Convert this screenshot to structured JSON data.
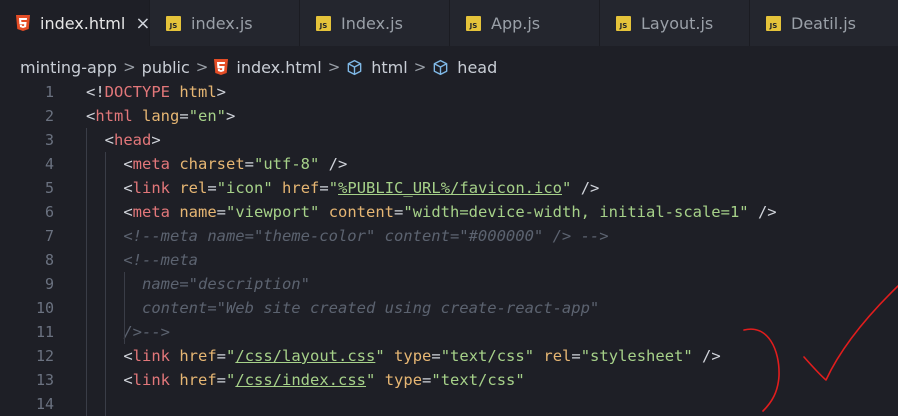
{
  "tabs": [
    {
      "label": "index.html",
      "icon": "html5-icon",
      "active": true,
      "close": "×"
    },
    {
      "label": "index.js",
      "icon": "js-file-icon"
    },
    {
      "label": "Index.js",
      "icon": "js-file-icon"
    },
    {
      "label": "App.js",
      "icon": "js-file-icon"
    },
    {
      "label": "Layout.js",
      "icon": "js-file-icon"
    },
    {
      "label": "Deatil.js",
      "icon": "js-file-icon"
    }
  ],
  "breadcrumb": {
    "items": [
      "minting-app",
      "public",
      "index.html",
      "html",
      "head"
    ],
    "separator": ">"
  },
  "code": {
    "lines": [
      {
        "num": "1",
        "tokens": [
          [
            "p",
            "<!"
          ],
          [
            "tag",
            "DOCTYPE"
          ],
          [
            "p",
            " "
          ],
          [
            "attr",
            "html"
          ],
          [
            "p",
            ">"
          ]
        ]
      },
      {
        "num": "2",
        "tokens": [
          [
            "p",
            "<"
          ],
          [
            "tag",
            "html"
          ],
          [
            "p",
            " "
          ],
          [
            "attr",
            "lang"
          ],
          [
            "p",
            "="
          ],
          [
            "str",
            "\"en\""
          ],
          [
            "p",
            ">"
          ]
        ]
      },
      {
        "num": "3",
        "tokens": [
          [
            "p",
            "  <"
          ],
          [
            "tag",
            "head"
          ],
          [
            "p",
            ">"
          ]
        ]
      },
      {
        "num": "4",
        "tokens": [
          [
            "p",
            "    <"
          ],
          [
            "tag",
            "meta"
          ],
          [
            "p",
            " "
          ],
          [
            "attr",
            "charset"
          ],
          [
            "p",
            "="
          ],
          [
            "str",
            "\"utf-8\""
          ],
          [
            "p",
            " />"
          ]
        ]
      },
      {
        "num": "5",
        "tokens": [
          [
            "p",
            "    <"
          ],
          [
            "tag",
            "link"
          ],
          [
            "p",
            " "
          ],
          [
            "attr",
            "rel"
          ],
          [
            "p",
            "="
          ],
          [
            "str",
            "\"icon\""
          ],
          [
            "p",
            " "
          ],
          [
            "attr",
            "href"
          ],
          [
            "p",
            "="
          ],
          [
            "str",
            "\""
          ],
          [
            "stru",
            "%PUBLIC_URL%/favicon.ico"
          ],
          [
            "str",
            "\""
          ],
          [
            "p",
            " />"
          ]
        ]
      },
      {
        "num": "6",
        "tokens": [
          [
            "p",
            "    <"
          ],
          [
            "tag",
            "meta"
          ],
          [
            "p",
            " "
          ],
          [
            "attr",
            "name"
          ],
          [
            "p",
            "="
          ],
          [
            "str",
            "\"viewport\""
          ],
          [
            "p",
            " "
          ],
          [
            "attr",
            "content"
          ],
          [
            "p",
            "="
          ],
          [
            "str",
            "\"width=device-width, initial-scale=1\""
          ],
          [
            "p",
            " />"
          ]
        ]
      },
      {
        "num": "7",
        "tokens": [
          [
            "com",
            "    <!--meta name=\"theme-color\" content=\"#000000\" /> -->"
          ]
        ]
      },
      {
        "num": "8",
        "tokens": [
          [
            "com",
            "    <!--meta"
          ]
        ]
      },
      {
        "num": "9",
        "tokens": [
          [
            "com",
            "      name=\"description\""
          ]
        ]
      },
      {
        "num": "10",
        "tokens": [
          [
            "com",
            "      content=\"Web site created using create-react-app\""
          ]
        ]
      },
      {
        "num": "11",
        "tokens": [
          [
            "com",
            "    />-->"
          ]
        ]
      },
      {
        "num": "12",
        "tokens": [
          [
            "p",
            "    <"
          ],
          [
            "tag",
            "link"
          ],
          [
            "p",
            " "
          ],
          [
            "attr",
            "href"
          ],
          [
            "p",
            "="
          ],
          [
            "str",
            "\""
          ],
          [
            "stru",
            "/css/layout.css"
          ],
          [
            "str",
            "\""
          ],
          [
            "p",
            " "
          ],
          [
            "attr",
            "type"
          ],
          [
            "p",
            "="
          ],
          [
            "str",
            "\"text/css\""
          ],
          [
            "p",
            " "
          ],
          [
            "attr",
            "rel"
          ],
          [
            "p",
            "="
          ],
          [
            "str",
            "\"stylesheet\""
          ],
          [
            "p",
            " />"
          ]
        ]
      },
      {
        "num": "13",
        "tokens": [
          [
            "p",
            "    <"
          ],
          [
            "tag",
            "link"
          ],
          [
            "p",
            " "
          ],
          [
            "attr",
            "href"
          ],
          [
            "p",
            "="
          ],
          [
            "str",
            "\""
          ],
          [
            "stru",
            "/css/index.css"
          ],
          [
            "str",
            "\""
          ],
          [
            "p",
            " "
          ],
          [
            "attr",
            "type"
          ],
          [
            "p",
            "="
          ],
          [
            "str",
            "\"text/css\""
          ]
        ]
      },
      {
        "num": "14",
        "tokens": []
      }
    ]
  },
  "colors": {
    "background": "#1e1f26",
    "tag": "#e2777a",
    "attribute": "#e6b673",
    "string": "#a6d189",
    "comment": "#5c6370",
    "annotation": "#e11d1d"
  }
}
